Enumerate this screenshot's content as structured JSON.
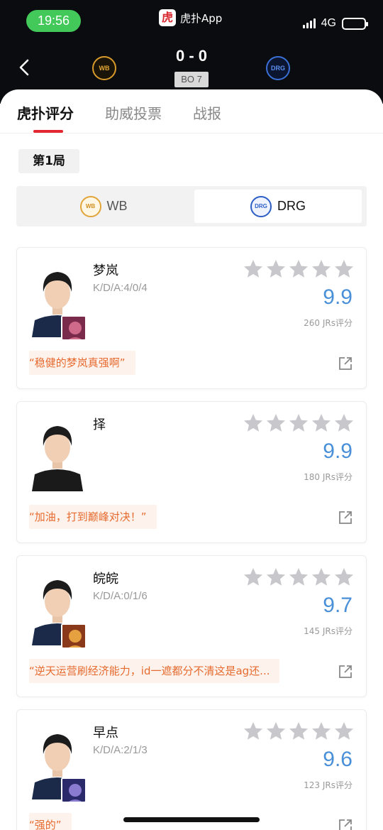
{
  "status_bar": {
    "time": "19:56",
    "app_name": "虎扑App",
    "app_logo_char": "虎",
    "network": "4G",
    "battery_color": "#43c85a"
  },
  "match": {
    "score": "0 - 0",
    "format": "BO 7",
    "team_left_logo_text": "WB",
    "team_right_logo_text": "DRG"
  },
  "tabs": [
    {
      "label": "虎扑评分",
      "active": true
    },
    {
      "label": "助威投票",
      "active": false
    },
    {
      "label": "战报",
      "active": false
    }
  ],
  "accent_color": "#e3262f",
  "rating_color": "#4a90d9",
  "game_label": "第1局",
  "team_switch": [
    {
      "name": "WB",
      "logo_text": "WB",
      "selected": false
    },
    {
      "name": "DRG",
      "logo_text": "DRG",
      "selected": true
    }
  ],
  "players": [
    {
      "name": "梦岚",
      "kda": "K/D/A:4/0/4",
      "rating": "9.9",
      "votes": "260 JRs评分",
      "comment": "“稳健的梦岚真强啊”",
      "has_hero": true
    },
    {
      "name": "择",
      "kda": "",
      "rating": "9.9",
      "votes": "180 JRs评分",
      "comment": "“加油，打到巅峰对决！”",
      "has_hero": false
    },
    {
      "name": "皖皖",
      "kda": "K/D/A:0/1/6",
      "rating": "9.7",
      "votes": "145 JRs评分",
      "comment": "“逆天运营刷经济能力，id一遮都分不清这是ag还...",
      "has_hero": true
    },
    {
      "name": "早点",
      "kda": "K/D/A:2/1/3",
      "rating": "9.6",
      "votes": "123 JRs评分",
      "comment": "“强的”",
      "has_hero": true
    }
  ]
}
